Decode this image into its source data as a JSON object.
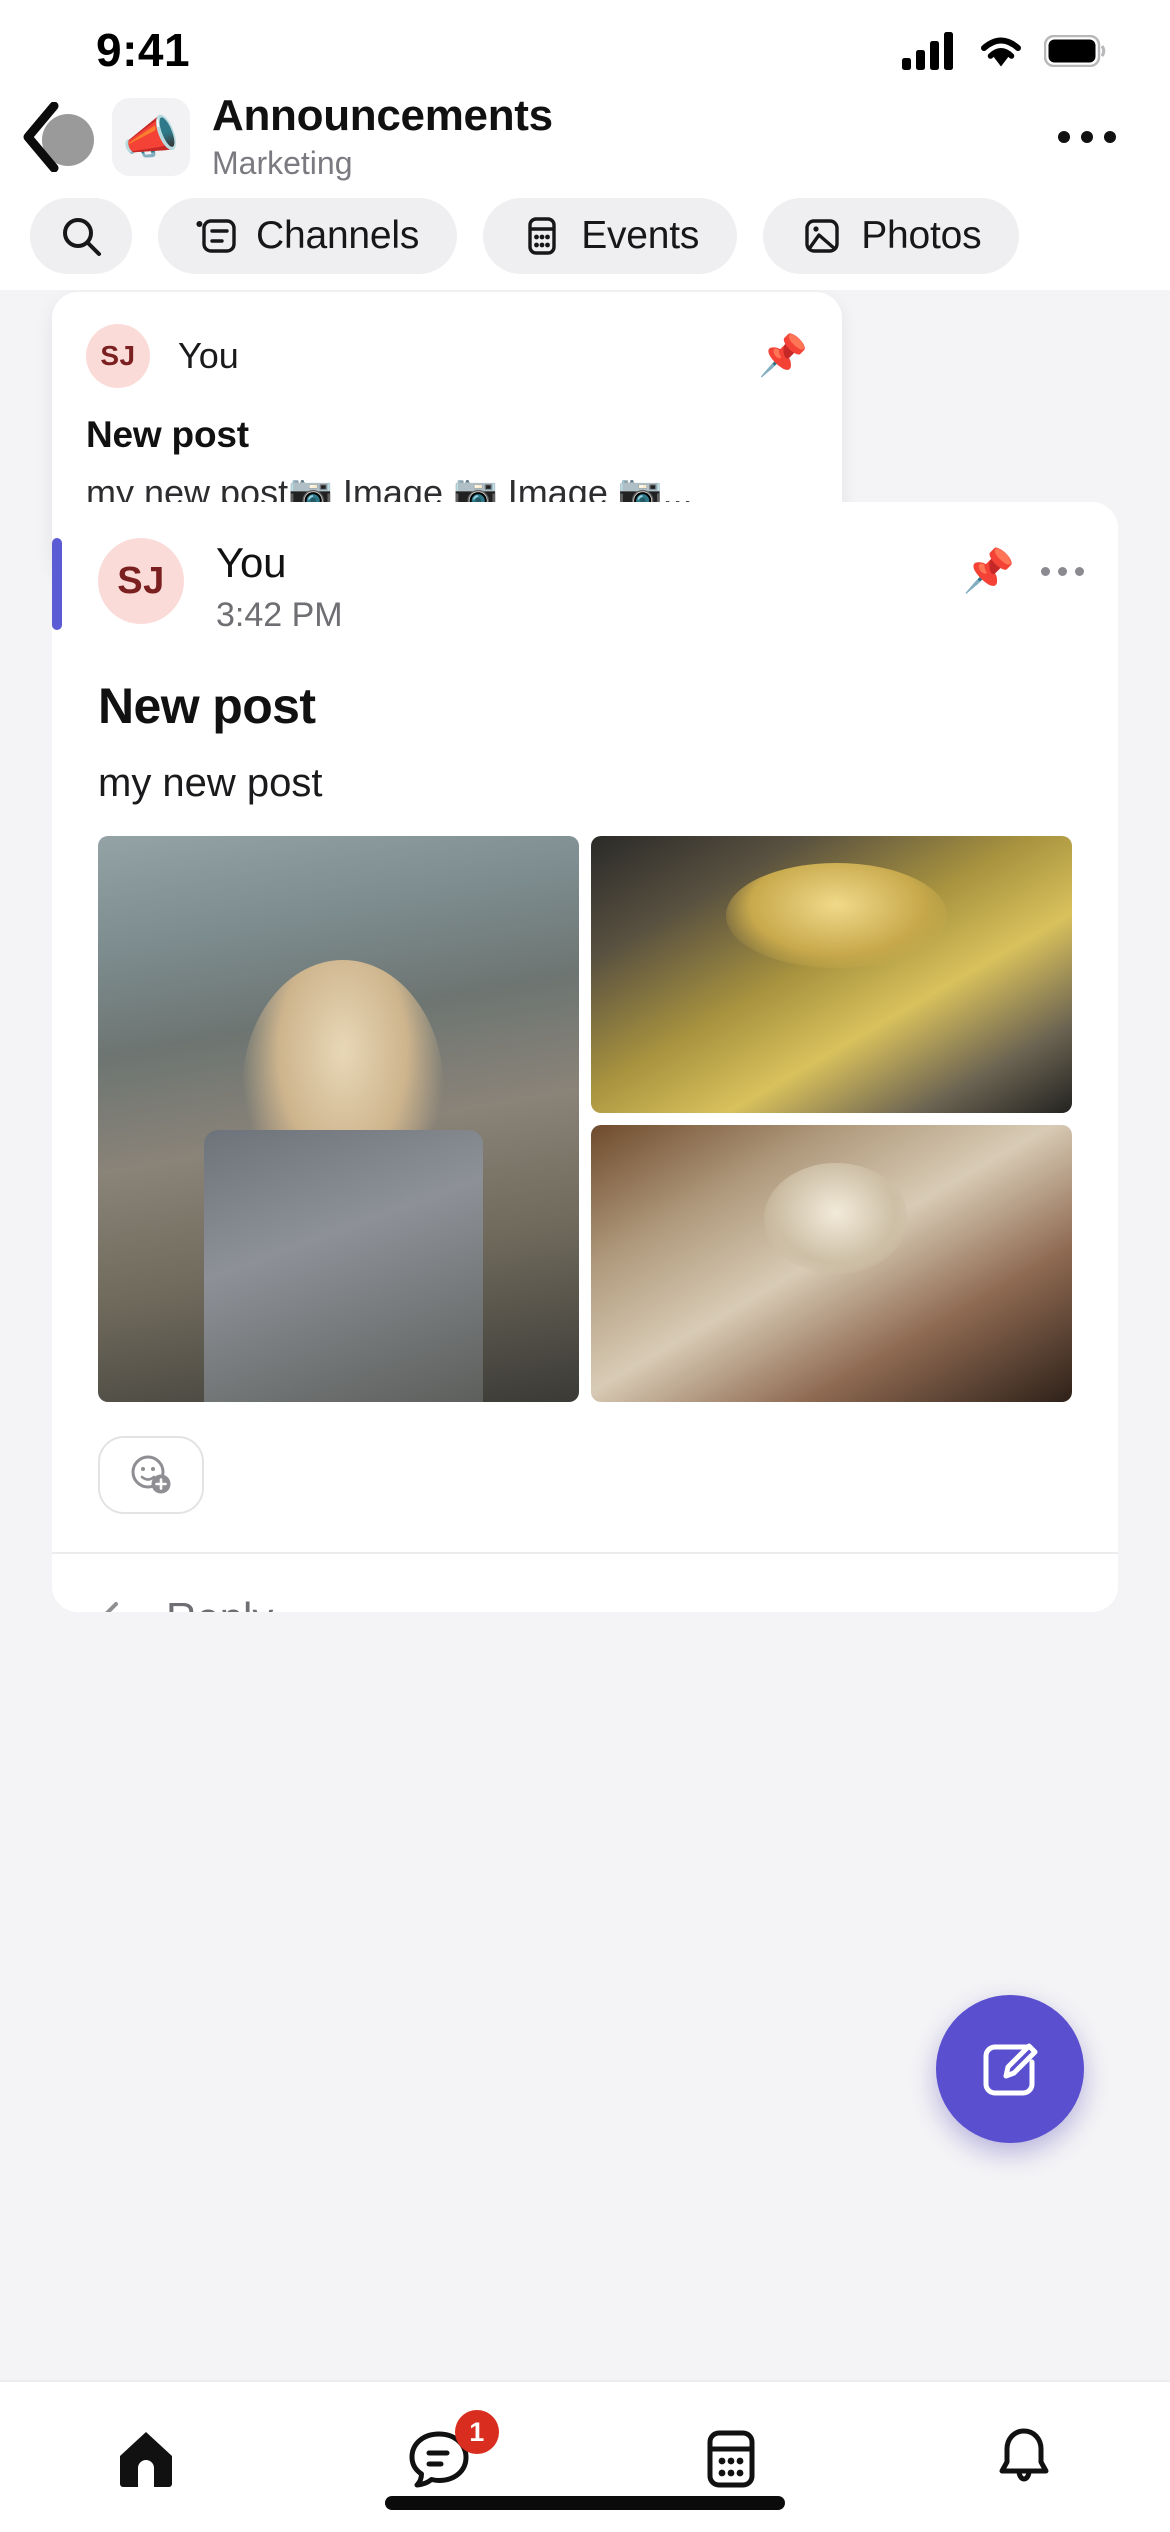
{
  "status_bar": {
    "time": "9:41",
    "cellular_icon": "cellular-signal-icon",
    "wifi_icon": "wifi-icon",
    "battery_icon": "battery-icon"
  },
  "header": {
    "back_icon": "back-chevron-icon",
    "channel_emoji": "📣",
    "title": "Announcements",
    "subtitle": "Marketing",
    "more_icon": "more-horizontal-icon"
  },
  "chips": [
    {
      "label": "",
      "icon": "search-icon",
      "icon_only": true
    },
    {
      "label": "Channels",
      "icon": "channels-icon",
      "icon_only": false
    },
    {
      "label": "Events",
      "icon": "events-calendar-icon",
      "icon_only": false
    },
    {
      "label": "Photos",
      "icon": "photos-image-icon",
      "icon_only": false
    }
  ],
  "pinned_preview": {
    "avatar_initials": "SJ",
    "author": "You",
    "pin_icon": "📌",
    "title": "New post",
    "preview_text": "my new post📷 Image 📷 Image 📷..."
  },
  "post": {
    "avatar_initials": "SJ",
    "author": "You",
    "time": "3:42 PM",
    "pin_icon": "📌",
    "more_icon": "more-horizontal-icon",
    "title": "New post",
    "body": "my new post",
    "images": [
      {
        "alt": "woman in plaid shirt outdoors",
        "cls": "ph1"
      },
      {
        "alt": "woman in yellow plaid jacket",
        "cls": "ph2"
      },
      {
        "alt": "woman in white shirt and plaid skirt",
        "cls": "ph3"
      }
    ],
    "add_reaction_icon": "add-reaction-icon",
    "reply_label": "Reply"
  },
  "fab": {
    "icon": "compose-icon",
    "color": "#5a4fcf"
  },
  "bottom_nav": [
    {
      "name": "home",
      "icon": "home-icon",
      "badge": ""
    },
    {
      "name": "chats",
      "icon": "chat-bubble-icon",
      "badge": "1"
    },
    {
      "name": "calendar",
      "icon": "calendar-icon",
      "badge": ""
    },
    {
      "name": "notifications",
      "icon": "bell-icon",
      "badge": ""
    }
  ],
  "colors": {
    "accent": "#5b5bd6",
    "fab": "#5a4fcf",
    "badge": "#d92d20",
    "avatar_bg": "#fadbd8",
    "feed_bg": "#f4f4f6"
  }
}
